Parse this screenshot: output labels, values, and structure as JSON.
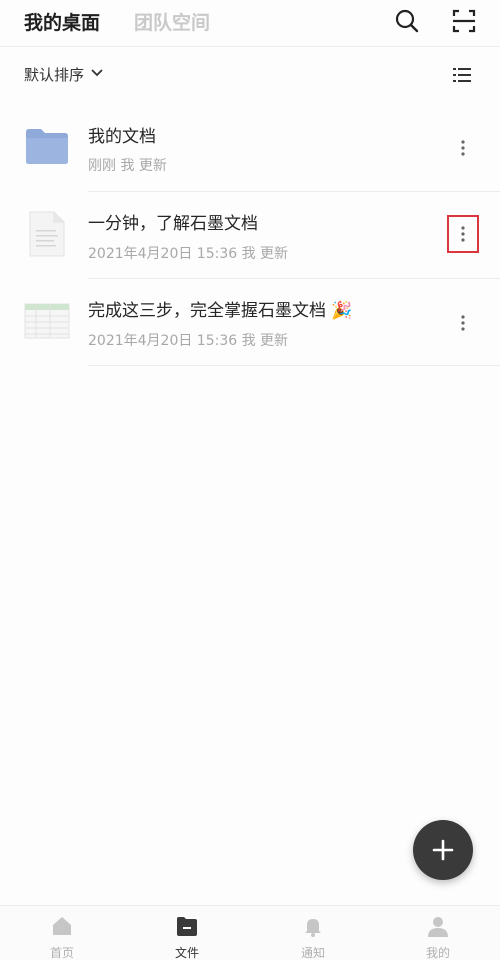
{
  "header": {
    "tab_active": "我的桌面",
    "tab_inactive": "团队空间"
  },
  "sort": {
    "label": "默认排序"
  },
  "files": [
    {
      "name": "我的文档",
      "meta": "刚刚 我 更新",
      "type": "folder"
    },
    {
      "name": "一分钟，了解石墨文档",
      "meta": "2021年4月20日 15:36 我 更新",
      "type": "document"
    },
    {
      "name": "完成这三步，完全掌握石墨文档 🎉",
      "meta": "2021年4月20日 15:36 我 更新",
      "type": "spreadsheet"
    }
  ],
  "nav": {
    "items": [
      {
        "label": "首页",
        "icon": "home-icon"
      },
      {
        "label": "文件",
        "icon": "file-icon"
      },
      {
        "label": "通知",
        "icon": "bell-icon"
      },
      {
        "label": "我的",
        "icon": "person-icon"
      }
    ],
    "active_index": 1
  },
  "colors": {
    "folder": "#8fa9d9",
    "highlight_box": "#d9363e",
    "fab": "#3a3a3a"
  }
}
